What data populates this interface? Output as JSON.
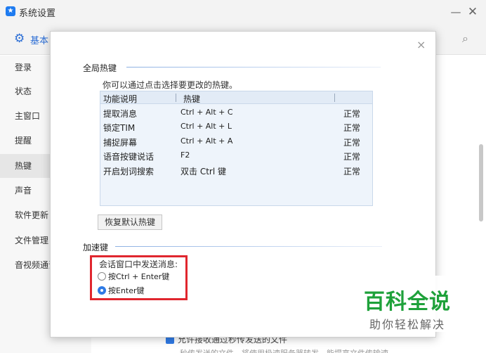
{
  "window": {
    "title": "系统设置",
    "logo_glyph": "★",
    "minimize_glyph": "—",
    "close_glyph": "✕"
  },
  "header": {
    "section_label": "基本"
  },
  "sidebar": {
    "items": [
      {
        "label": "登录"
      },
      {
        "label": "状态"
      },
      {
        "label": "主窗口"
      },
      {
        "label": "提醒"
      },
      {
        "label": "热键",
        "active": true
      },
      {
        "label": "声音"
      },
      {
        "label": "软件更新"
      },
      {
        "label": "文件管理"
      },
      {
        "label": "音视频通话"
      }
    ]
  },
  "background_content": {
    "bottom_option": "允许接收通过秒传发送的文件",
    "bottom_note": "秒传发送的文件，将使用极速服务器转发，能提高文件传输速"
  },
  "dialog": {
    "close_glyph": "×",
    "global_hotkeys": {
      "title": "全局热键",
      "hint": "你可以通过点击选择要更改的热键。",
      "columns": [
        "功能说明",
        "热键"
      ],
      "rows": [
        {
          "func": "提取消息",
          "key": "Ctrl + Alt + C",
          "status": "正常"
        },
        {
          "func": "锁定TIM",
          "key": "Ctrl + Alt + L",
          "status": "正常"
        },
        {
          "func": "捕捉屏幕",
          "key": "Ctrl + Alt + A",
          "status": "正常"
        },
        {
          "func": "语音按键说话",
          "key": "F2",
          "status": "正常"
        },
        {
          "func": "开启划词搜索",
          "key": "双击 Ctrl 键",
          "status": "正常"
        }
      ],
      "restore_button": "恢复默认热键"
    },
    "accelerator": {
      "title": "加速键",
      "label": "会话窗口中发送消息:",
      "options": [
        {
          "label": "按Ctrl + Enter键",
          "selected": false
        },
        {
          "label": "按Enter键",
          "selected": true
        }
      ]
    }
  },
  "watermark": {
    "title": "百科全说",
    "subtitle": "助你轻松解决"
  },
  "colors": {
    "accent": "#2c6ed5",
    "highlight_border": "#e0262e",
    "watermark_green": "#1ea13a"
  }
}
